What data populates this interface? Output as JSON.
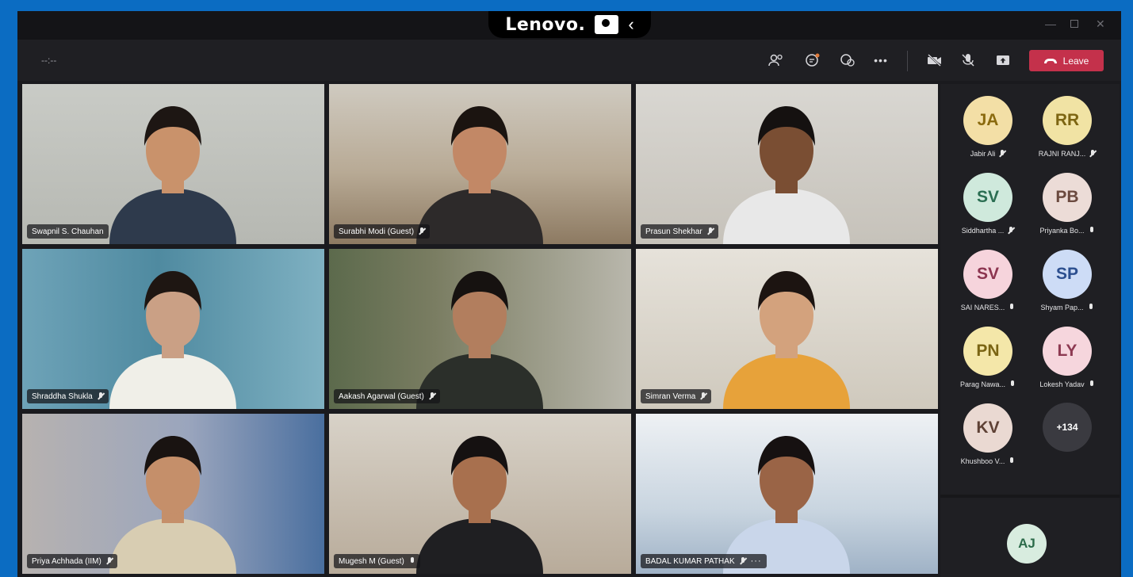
{
  "brand": {
    "name": "Lenovo."
  },
  "toolbar": {
    "timer": "--:--",
    "leave_label": "Leave"
  },
  "tiles": [
    {
      "name": "Swapnil S. Chauhan",
      "mic": "none",
      "active": true
    },
    {
      "name": "Surabhi Modi (Guest)",
      "mic": "muted"
    },
    {
      "name": "Prasun Shekhar",
      "mic": "muted"
    },
    {
      "name": "Shraddha Shukla",
      "mic": "muted"
    },
    {
      "name": "Aakash Agarwal (Guest)",
      "mic": "muted"
    },
    {
      "name": "Simran Verma",
      "mic": "muted"
    },
    {
      "name": "Priya Achhada (IIM)",
      "mic": "muted"
    },
    {
      "name": "Mugesh M (Guest)",
      "mic": "on"
    },
    {
      "name": "BADAL KUMAR PATHAK",
      "mic": "muted",
      "more": "···"
    }
  ],
  "participants": [
    {
      "initials": "JA",
      "name": "Jabir Ali",
      "mic": "muted",
      "bg": "#f3dfa6",
      "fg": "#8a6a0e"
    },
    {
      "initials": "RR",
      "name": "RAJNI RANJ...",
      "mic": "muted",
      "bg": "#f1e3a4",
      "fg": "#7d6512"
    },
    {
      "initials": "SV",
      "name": "Siddhartha ...",
      "mic": "muted",
      "bg": "#cfe9dc",
      "fg": "#2b6e52"
    },
    {
      "initials": "PB",
      "name": "Priyanka Bo...",
      "mic": "on",
      "bg": "#ecdcd7",
      "fg": "#6b4a3f"
    },
    {
      "initials": "SV",
      "name": "SAI NARES...",
      "mic": "on",
      "bg": "#f6d4dc",
      "fg": "#8c3550"
    },
    {
      "initials": "SP",
      "name": "Shyam Pap...",
      "mic": "on",
      "bg": "#cddcf6",
      "fg": "#2c4f8f"
    },
    {
      "initials": "PN",
      "name": "Parag Nawa...",
      "mic": "on",
      "bg": "#f4e7a9",
      "fg": "#7a6413"
    },
    {
      "initials": "LY",
      "name": "Lokesh Yadav",
      "mic": "on",
      "bg": "#f6d6dd",
      "fg": "#8d3a52"
    },
    {
      "initials": "KV",
      "name": "Khushboo V...",
      "mic": "on",
      "bg": "#ead9d2",
      "fg": "#5e4135"
    }
  ],
  "overflow_count": "+134",
  "speaker": {
    "initials": "AJ",
    "bg": "#d8ecdf",
    "fg": "#2c6b4a"
  },
  "colors": {
    "leave": "#c4314b",
    "active_outline": "#8c8fe8",
    "background": "#0b6cc2"
  }
}
